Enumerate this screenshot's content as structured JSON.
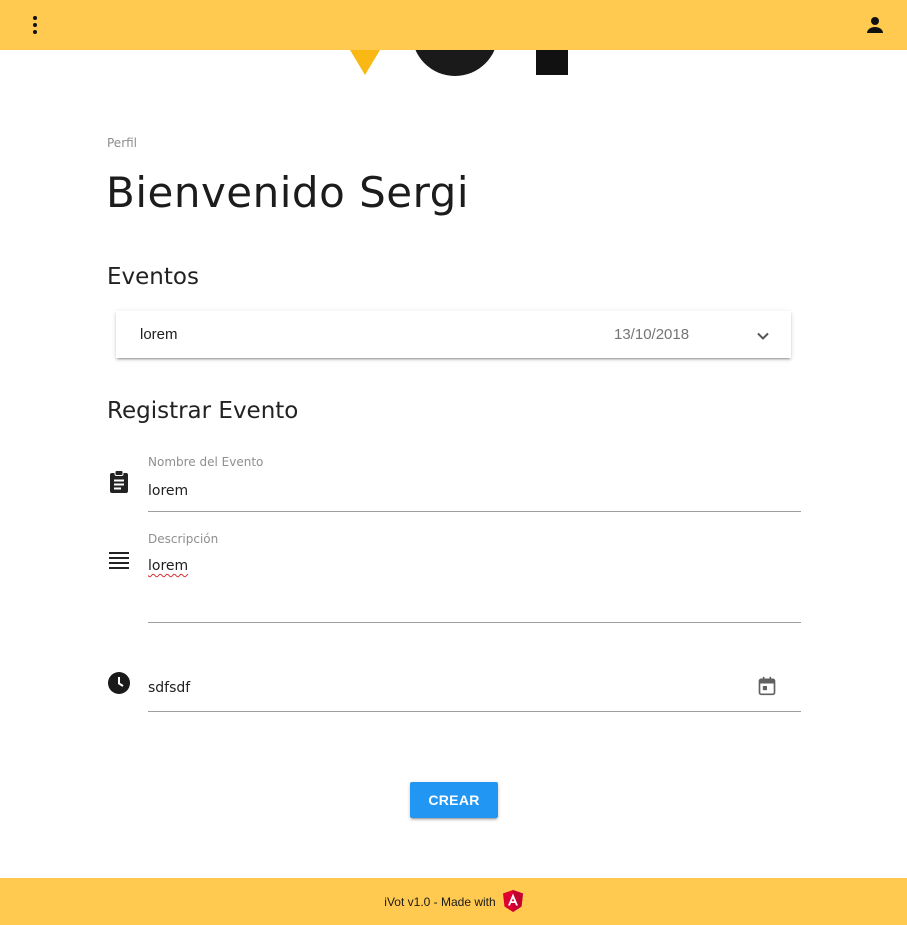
{
  "toolbar": {
    "menu_icon": "more-vert-icon",
    "user_icon": "account-icon",
    "color": "#ffca4f"
  },
  "page": {
    "breadcrumb": "Perfil",
    "title": "Bienvenido Sergi"
  },
  "events": {
    "heading": "Eventos",
    "items": [
      {
        "name": "lorem",
        "date": "13/10/2018",
        "icon": "chevron-down-icon"
      }
    ]
  },
  "register": {
    "heading": "Registrar Evento",
    "name_field": {
      "label": "Nombre del Evento",
      "value": "lorem",
      "icon": "assignment-icon"
    },
    "description_field": {
      "label": "Descripción",
      "value": "lorem",
      "icon": "notes-icon"
    },
    "date_field": {
      "value": "sdfsdf",
      "icon": "clock-icon",
      "picker_icon": "calendar-icon"
    },
    "submit_label": "CREAR",
    "accent": "#2196f3"
  },
  "footer": {
    "text": "iVot v1.0 - Made with",
    "logo_icon": "angular-logo-icon"
  }
}
